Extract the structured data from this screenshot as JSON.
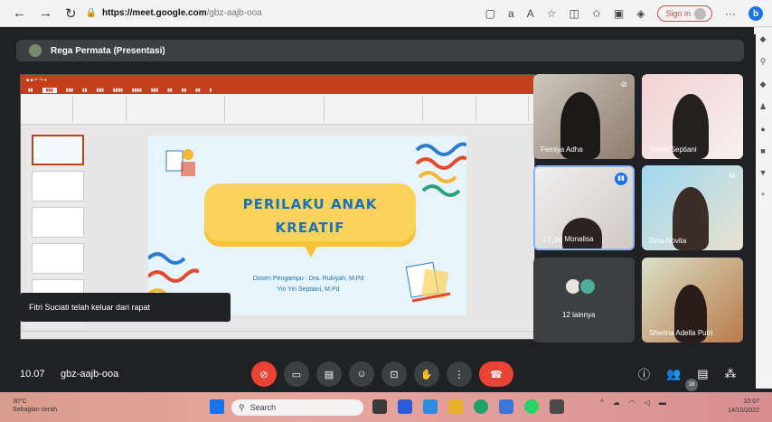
{
  "browser": {
    "url_host": "https://meet.google.com",
    "url_path": "/gbz-aajb-ooa",
    "signin_label": "Sign in"
  },
  "meet": {
    "presenter_label": "Rega Permata (Presentasi)",
    "slide": {
      "title_line1": "PERILAKU ANAK",
      "title_line2": "KREATIF",
      "dosen_line1": "Dosen Pengampu : Dra. Rukiyah, M.Pd",
      "dosen_line2": "Yin Yin Septiani, M.Pd"
    },
    "toast": "Fitri Suciati telah keluar dari rapat",
    "participants": [
      {
        "name": "Femiya Adha"
      },
      {
        "name": "Yinyin Septiani"
      },
      {
        "name": "13_pg Monalisa"
      },
      {
        "name": "Dina Novita"
      },
      {
        "name": "12 lainnya"
      },
      {
        "name": "Sherina Adella Putri"
      }
    ],
    "time": "10.07",
    "meeting_code": "gbz-aajb-ooa",
    "people_count": "18"
  },
  "taskbar": {
    "temp": "30°C",
    "weather": "Sebagian cerah",
    "search": "Search",
    "clock_time": "10:07",
    "clock_date": "14/10/2022"
  },
  "colors": {
    "meet_bg": "#202124",
    "tile_bg": "#3c4043",
    "accent_red": "#ea4335",
    "ppt_red": "#c43e1c",
    "slide_title": "#1a72b9",
    "bubble": "#fbd35a"
  }
}
